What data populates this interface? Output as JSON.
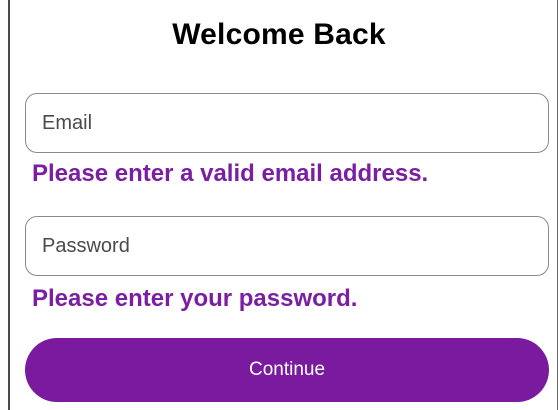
{
  "form": {
    "title": "Welcome Back",
    "email": {
      "placeholder": "Email",
      "value": "",
      "error": "Please enter a valid email address."
    },
    "password": {
      "placeholder": "Password",
      "value": "",
      "error": "Please enter your password."
    },
    "continue_label": "Continue"
  },
  "colors": {
    "error_text": "#7b1fa2",
    "button_bg": "#7a1a9e",
    "button_text": "#ffffff",
    "field_border": "#8a8a8a"
  }
}
